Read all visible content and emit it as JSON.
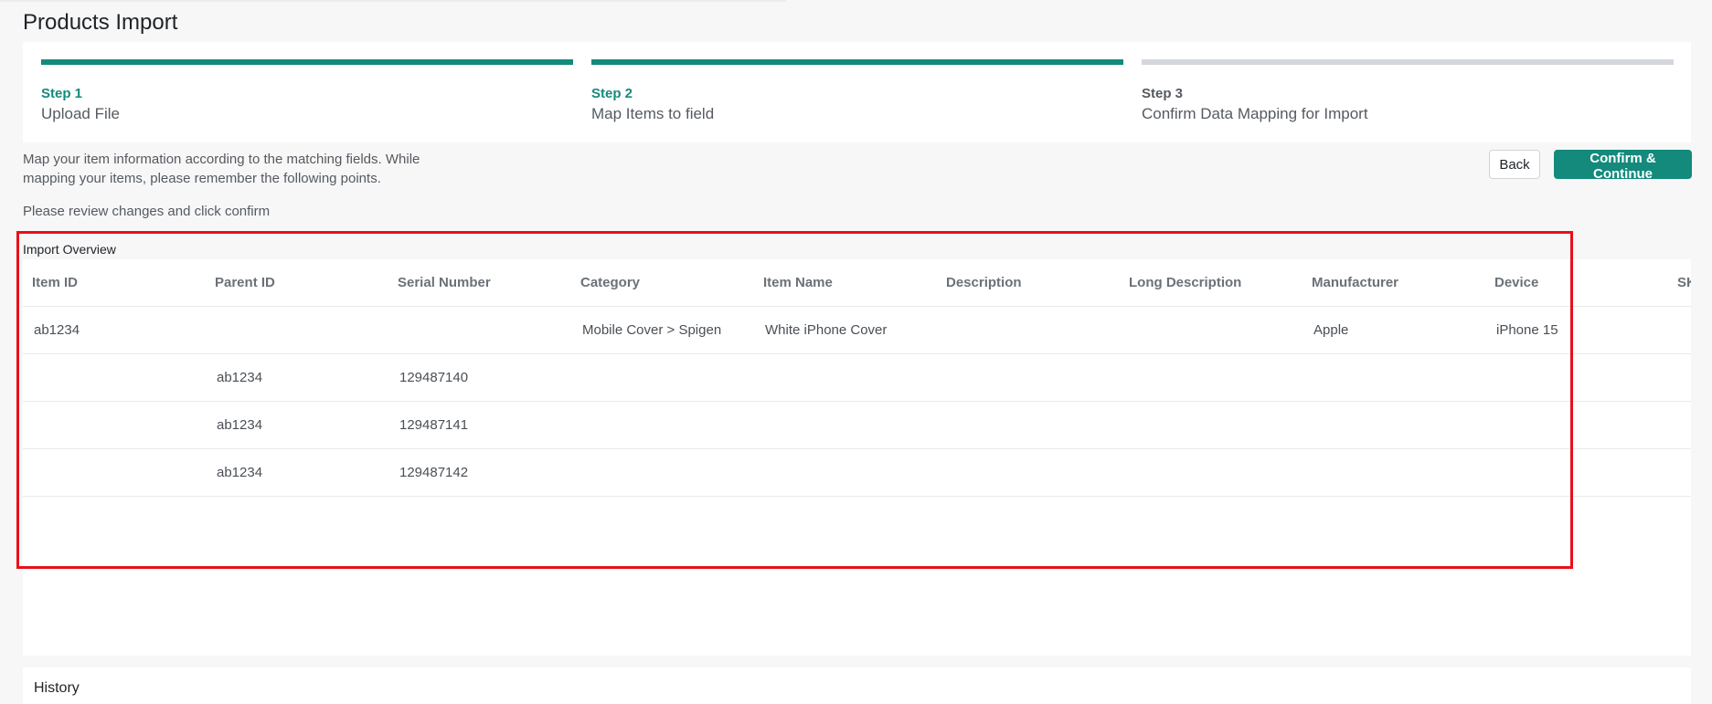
{
  "page": {
    "title": "Products Import"
  },
  "stepper": {
    "steps": [
      {
        "num": "Step 1",
        "label": "Upload File"
      },
      {
        "num": "Step 2",
        "label": "Map Items to field"
      },
      {
        "num": "Step 3",
        "label": "Confirm Data Mapping for Import"
      }
    ]
  },
  "intro": {
    "text": "Map your item information according to the matching fields. While mapping your items, please remember the following points.",
    "review": "Please review changes and click confirm"
  },
  "actions": {
    "back_label": "Back",
    "confirm_label": "Confirm & Continue"
  },
  "overview": {
    "title": "Import Overview",
    "columns": [
      "Item ID",
      "Parent ID",
      "Serial Number",
      "Category",
      "Item Name",
      "Description",
      "Long Description",
      "Manufacturer",
      "Device",
      "SK"
    ],
    "rows": [
      [
        "ab1234",
        "",
        "",
        "Mobile Cover > Spigen",
        "White iPhone Cover",
        "",
        "",
        "Apple",
        "iPhone 15",
        ""
      ],
      [
        "",
        "ab1234",
        "129487140",
        "",
        "",
        "",
        "",
        "",
        "",
        ""
      ],
      [
        "",
        "ab1234",
        "129487141",
        "",
        "",
        "",
        "",
        "",
        "",
        ""
      ],
      [
        "",
        "ab1234",
        "129487142",
        "",
        "",
        "",
        "",
        "",
        "",
        ""
      ]
    ]
  },
  "history": {
    "title": "History"
  },
  "colors": {
    "accent": "#138a7c",
    "highlight": "#e8101a"
  }
}
